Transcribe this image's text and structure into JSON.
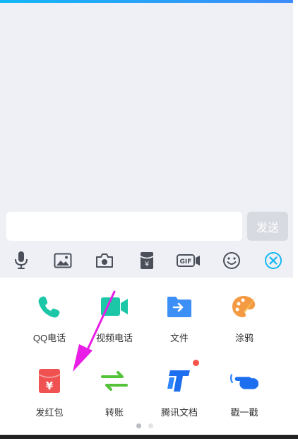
{
  "input": {
    "value": "",
    "placeholder": ""
  },
  "send_label": "发送",
  "toolbar_icons": [
    "mic-icon",
    "image-icon",
    "camera-icon",
    "red-packet-icon",
    "gif-icon",
    "emoji-icon",
    "close-icon"
  ],
  "panel": {
    "row1": [
      {
        "label": "QQ电话",
        "icon": "phone-icon"
      },
      {
        "label": "视频电话",
        "icon": "video-call-icon"
      },
      {
        "label": "文件",
        "icon": "file-icon"
      },
      {
        "label": "涂鸦",
        "icon": "palette-icon"
      }
    ],
    "row2": [
      {
        "label": "发红包",
        "icon": "red-packet-icon"
      },
      {
        "label": "转账",
        "icon": "transfer-icon"
      },
      {
        "label": "腾讯文档",
        "icon": "tencent-docs-icon"
      },
      {
        "label": "戳一戳",
        "icon": "poke-icon"
      }
    ],
    "page_indicator": {
      "pages": 2,
      "current": 1
    }
  },
  "colors": {
    "accent": "#12b7f5",
    "send_disabled": "#d7dae0",
    "annotation_arrow": "#e91ee6",
    "badge": "#f5544a"
  }
}
